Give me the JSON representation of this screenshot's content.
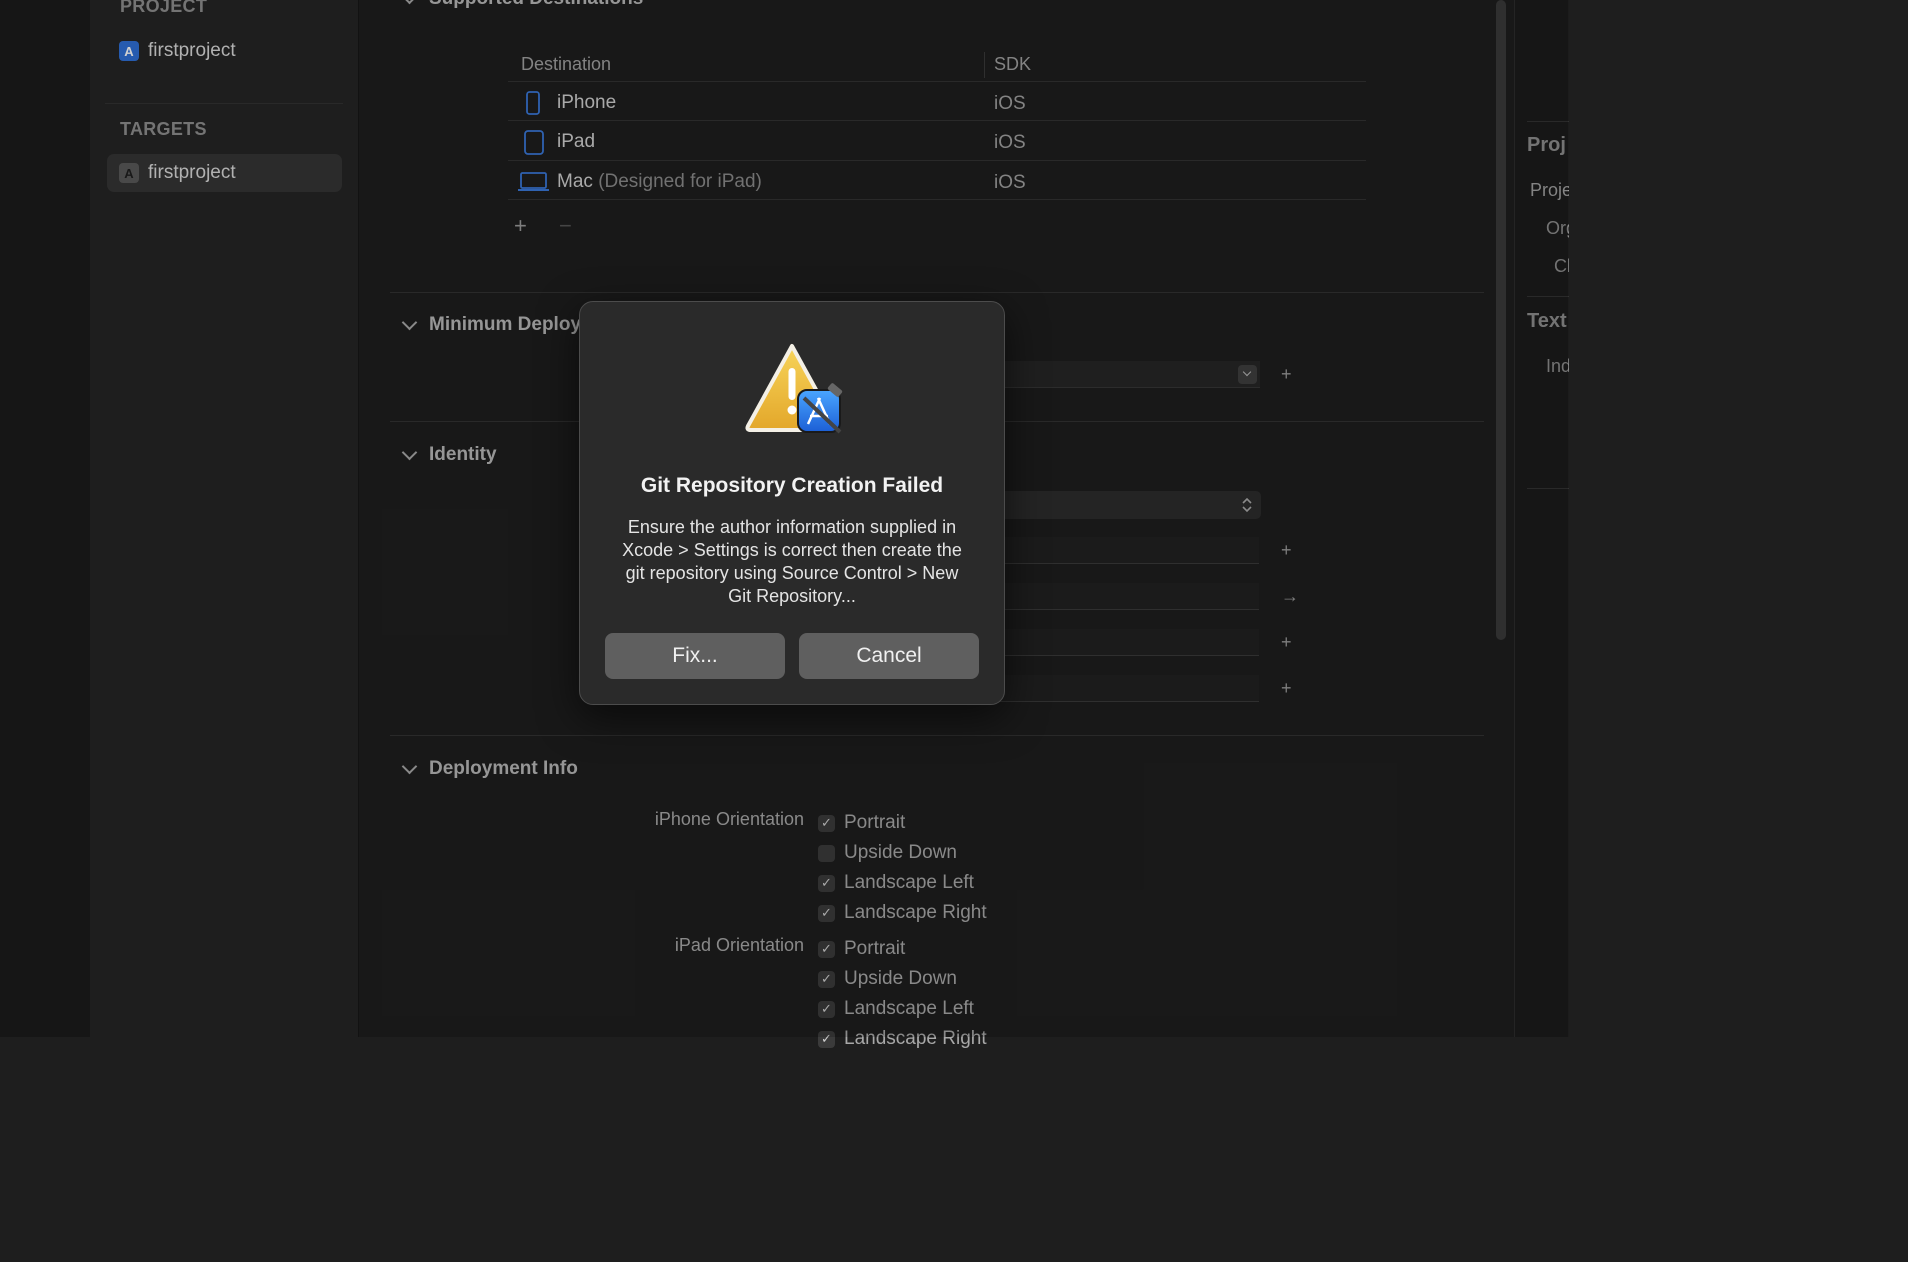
{
  "sidebar": {
    "project_heading": "PROJECT",
    "project_item": "firstproject",
    "targets_heading": "TARGETS",
    "target_item": "firstproject"
  },
  "supported_destinations": {
    "title": "Supported Destinations",
    "columns": [
      "Destination",
      "SDK"
    ],
    "rows": [
      {
        "name": "iPhone",
        "sub": "",
        "sdk": "iOS",
        "icon": "iphone-icon"
      },
      {
        "name": "iPad",
        "sub": "",
        "sdk": "iOS",
        "icon": "ipad-icon"
      },
      {
        "name": "Mac",
        "sub": "(Designed for iPad)",
        "sdk": "iOS",
        "icon": "mac-icon"
      }
    ],
    "add_symbol": "+",
    "remove_symbol": "−"
  },
  "minimum_deployments": {
    "title": "Minimum Deploy"
  },
  "identity": {
    "title": "Identity"
  },
  "deployment_info": {
    "title": "Deployment Info",
    "iphone_label": "iPhone Orientation",
    "iphone_options": [
      {
        "label": "Portrait",
        "checked": true
      },
      {
        "label": "Upside Down",
        "checked": false
      },
      {
        "label": "Landscape Left",
        "checked": true
      },
      {
        "label": "Landscape Right",
        "checked": true
      }
    ],
    "ipad_label": "iPad Orientation",
    "ipad_options": [
      {
        "label": "Portrait",
        "checked": true
      },
      {
        "label": "Upside Down",
        "checked": true
      },
      {
        "label": "Landscape Left",
        "checked": true
      },
      {
        "label": "Landscape Right",
        "checked": true
      }
    ]
  },
  "right_panel": {
    "heading1": "Proj",
    "item1": "Proje",
    "item2": "Org",
    "item3": "Cl",
    "heading2": "Text",
    "item4": "Ind"
  },
  "dialog": {
    "title": "Git Repository Creation Failed",
    "message": "Ensure the author information supplied in Xcode > Settings is correct then create the git repository using Source Control > New Git Repository...",
    "fix_label": "Fix...",
    "cancel_label": "Cancel"
  },
  "colors": {
    "background": "#1e1e1e",
    "accent": "#2f6fd6",
    "warning": "#f0c040"
  }
}
